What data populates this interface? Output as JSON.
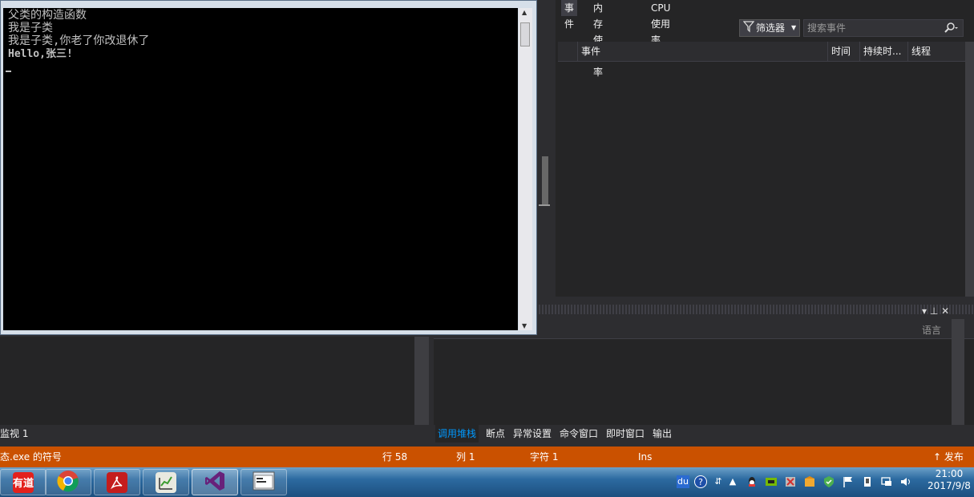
{
  "console": {
    "lines": [
      "父类的构造函数",
      "我是子类",
      "我是子类,你老了你改退休了",
      "Hello,张三!"
    ]
  },
  "diagnostics": {
    "tabs": [
      "事件",
      "内存使用率",
      "CPU 使用率"
    ],
    "filter_label": "筛选器",
    "search_placeholder": "搜索事件",
    "columns": [
      "事件",
      "时间",
      "持续时...",
      "线程"
    ]
  },
  "lower_panel": {
    "column_language": "语言",
    "controls": "▾ ⊥ ✕"
  },
  "watch_label": "监视 1",
  "tool_tabs": [
    "调用堆栈",
    "断点",
    "异常设置",
    "命令窗口",
    "即时窗口",
    "输出"
  ],
  "status_bar": {
    "left": "态.exe 的符号",
    "line": "行 58",
    "col": "列 1",
    "char": "字符 1",
    "mode": "Ins",
    "publish": "↑ 发布"
  },
  "taskbar": {
    "apps": [
      {
        "icon": "youdao-icon",
        "label": "有道"
      },
      {
        "icon": "chrome-icon",
        "label": ""
      },
      {
        "icon": "acrobat-icon",
        "label": ""
      },
      {
        "icon": "chart-editor-icon",
        "label": ""
      },
      {
        "icon": "visual-studio-icon",
        "label": ""
      },
      {
        "icon": "console-window-icon",
        "label": ""
      }
    ],
    "clock_time": "21:00",
    "clock_date": "2017/9/8",
    "tray_baidu": "du"
  },
  "colors": {
    "status_bar": "#ca5100",
    "active_tab": "#0097fb",
    "vs_background": "#2d2d30"
  }
}
